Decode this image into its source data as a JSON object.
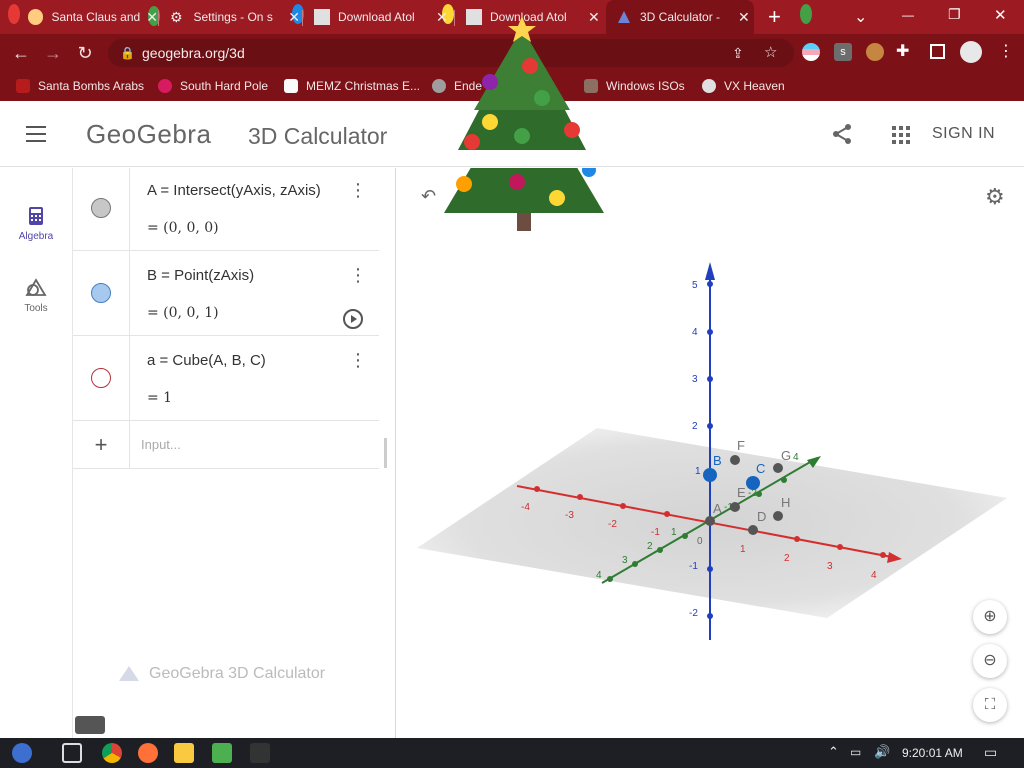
{
  "tabs": [
    {
      "title": "Santa Claus and",
      "close": "✕"
    },
    {
      "title": "Settings - On s",
      "close": "✕"
    },
    {
      "title": "Download Atol",
      "close": "✕"
    },
    {
      "title": "Download Atol",
      "close": "✕"
    },
    {
      "title": "3D Calculator -",
      "close": "✕"
    }
  ],
  "new_tab": "+",
  "window_controls": {
    "down": "⌄",
    "minimize": "—",
    "restore": "❐",
    "close": "✕"
  },
  "address": {
    "url": "geogebra.org/3d"
  },
  "bookmarks": [
    "Santa Bombs Arabs",
    "South Hard Pole",
    "MEMZ Christmas E...",
    "Ende",
    "Windows ISOs",
    "VX Heaven"
  ],
  "app": {
    "logo": "GeoGebra",
    "title": "3D Calculator",
    "sign_in": "SIGN IN"
  },
  "rail": {
    "algebra": "Algebra",
    "tools": "Tools"
  },
  "algebra": {
    "rows": [
      {
        "definition": "A  =  Intersect(yAxis, zAxis)",
        "value": "=  (0,  0,  0)",
        "dot_color": "#c7c7c7",
        "dot_border": "#777777"
      },
      {
        "definition": "B  =  Point(zAxis)",
        "value": "=  (0,  0,  1)",
        "dot_color": "#a7c9ef",
        "dot_border": "#4a7fc1"
      },
      {
        "definition": "a  =  Cube(A, B, C)",
        "value": "=  1",
        "dot_color": "#ffffff",
        "dot_border": "#b5323a"
      }
    ],
    "input_placeholder": "Input...",
    "add_symbol": "+",
    "footer": "GeoGebra 3D Calculator"
  },
  "graphics": {
    "points": [
      "A",
      "B",
      "C",
      "D",
      "E",
      "F",
      "G",
      "H"
    ],
    "z_ticks": [
      "5",
      "4",
      "3",
      "2",
      "1",
      "-1",
      "-2"
    ],
    "x_ticks": [
      "-4",
      "-3",
      "-2",
      "-1",
      "1",
      "2",
      "3",
      "4"
    ],
    "y_ticks": [
      "4",
      "3",
      "2",
      "1",
      "-1",
      "-2",
      "4"
    ],
    "origin": "0"
  },
  "taskbar": {
    "time": "9:20:01 AM"
  },
  "colors": {
    "chrome_red": "#9c1a22",
    "x_axis": "#d32f2f",
    "y_axis": "#2e7d32",
    "z_axis": "#1f3fbf",
    "point_blue": "#1565c0"
  }
}
